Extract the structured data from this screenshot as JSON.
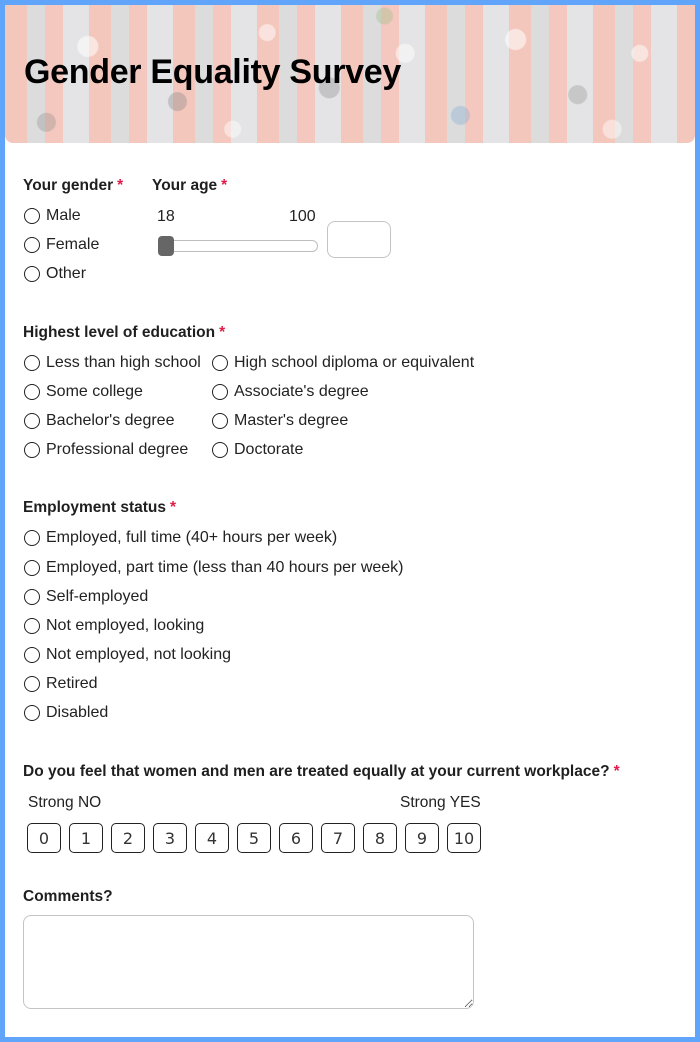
{
  "header": {
    "title": "Gender Equality Survey"
  },
  "questions": {
    "gender": {
      "label": "Your gender",
      "required_mark": "*",
      "options": [
        "Male",
        "Female",
        "Other"
      ]
    },
    "age": {
      "label": "Your age",
      "required_mark": "*",
      "min_label": "18",
      "max_label": "100",
      "slider_value": 18,
      "input_value": ""
    },
    "education": {
      "label": "Highest level of education",
      "required_mark": "*",
      "options": [
        "Less than high school",
        "High school diploma or equivalent",
        "Some college",
        "Associate's degree",
        "Bachelor's degree",
        "Master's degree",
        "Professional degree",
        "Doctorate"
      ]
    },
    "employment": {
      "label": "Employment status",
      "required_mark": "*",
      "options": [
        "Employed, full time (40+ hours per week)",
        "Employed, part time (less than 40 hours per week)",
        "Self-employed",
        "Not employed, looking",
        "Not employed, not looking",
        "Retired",
        "Disabled"
      ]
    },
    "equality": {
      "label": "Do you feel that women and men are treated equally at your current workplace?",
      "required_mark": "*",
      "low_label": "Strong NO",
      "high_label": "Strong YES",
      "scale": [
        "0",
        "1",
        "2",
        "3",
        "4",
        "5",
        "6",
        "7",
        "8",
        "9",
        "10"
      ]
    },
    "comments": {
      "label": "Comments?",
      "value": ""
    }
  },
  "colors": {
    "frame_border": "#60a5fa",
    "required": "#e11d48",
    "slider_thumb": "#666666"
  }
}
